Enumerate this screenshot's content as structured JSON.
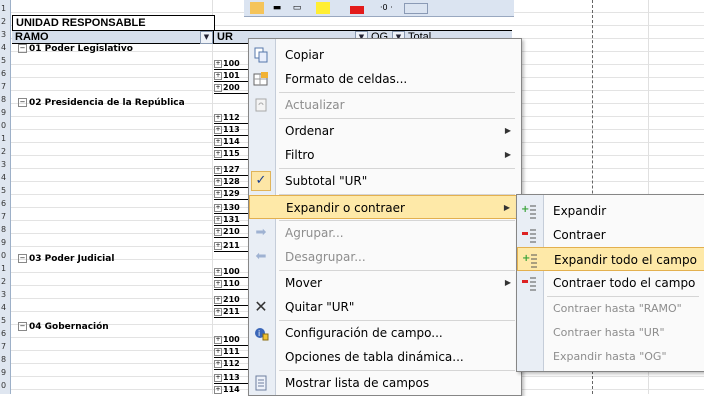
{
  "pivot": {
    "header_top": "UNIDAD RESPONSABLE",
    "col_ramo": "RAMO",
    "col_ur": "UR",
    "col_og": "OG",
    "col_total": "Total",
    "ramos": [
      {
        "label": "01 Poder Legislativo"
      },
      {
        "label": "02 Presidencia de la República"
      },
      {
        "label": "03 Poder Judicial"
      },
      {
        "label": "04 Gobernación"
      }
    ],
    "ur_codes": [
      "100",
      "101",
      "200",
      "112",
      "113",
      "114",
      "115",
      "127",
      "128",
      "129",
      "130",
      "131",
      "210",
      "211",
      "100",
      "110",
      "210",
      "211",
      "100",
      "111",
      "112",
      "113",
      "114"
    ]
  },
  "context_menu": {
    "items": [
      {
        "label": "Copiar",
        "icon": "copy-icon",
        "enabled": true
      },
      {
        "label": "Formato de celdas...",
        "icon": "format-cells-icon",
        "enabled": true
      },
      {
        "label": "Actualizar",
        "icon": "refresh-icon",
        "enabled": false
      },
      {
        "label": "Ordenar",
        "icon": "",
        "enabled": true,
        "submenu": true
      },
      {
        "label": "Filtro",
        "icon": "",
        "enabled": true,
        "submenu": true
      },
      {
        "label": "Subtotal \"UR\"",
        "icon": "check-icon",
        "enabled": true,
        "checked": true
      },
      {
        "label": "Expandir o contraer",
        "icon": "",
        "enabled": true,
        "submenu": true,
        "highlighted": true
      },
      {
        "label": "Agrupar...",
        "icon": "group-icon",
        "enabled": false
      },
      {
        "label": "Desagrupar...",
        "icon": "ungroup-icon",
        "enabled": false
      },
      {
        "label": "Mover",
        "icon": "",
        "enabled": true,
        "submenu": true
      },
      {
        "label": "Quitar \"UR\"",
        "icon": "remove-x-icon",
        "enabled": true
      },
      {
        "label": "Configuración de campo...",
        "icon": "field-settings-icon",
        "enabled": true
      },
      {
        "label": "Opciones de tabla dinámica...",
        "icon": "",
        "enabled": true
      },
      {
        "label": "Mostrar lista de campos",
        "icon": "field-list-icon",
        "enabled": true
      }
    ]
  },
  "submenu": {
    "items": [
      {
        "label": "Expandir",
        "icon": "expand-icon",
        "enabled": true
      },
      {
        "label": "Contraer",
        "icon": "collapse-icon",
        "enabled": true
      },
      {
        "label": "Expandir todo el campo",
        "icon": "expand-all-icon",
        "enabled": true,
        "highlighted": true
      },
      {
        "label": "Contraer todo el campo",
        "icon": "collapse-all-icon",
        "enabled": true
      },
      {
        "label": "Contraer hasta \"RAMO\"",
        "icon": "",
        "enabled": false
      },
      {
        "label": "Contraer hasta \"UR\"",
        "icon": "",
        "enabled": false
      },
      {
        "label": "Expandir hasta \"OG\"",
        "icon": "",
        "enabled": false
      }
    ]
  },
  "colors": {
    "highlight": "#fee9a8",
    "header_fill": "#d6dfec",
    "disabled_text": "#8d8d8d"
  }
}
